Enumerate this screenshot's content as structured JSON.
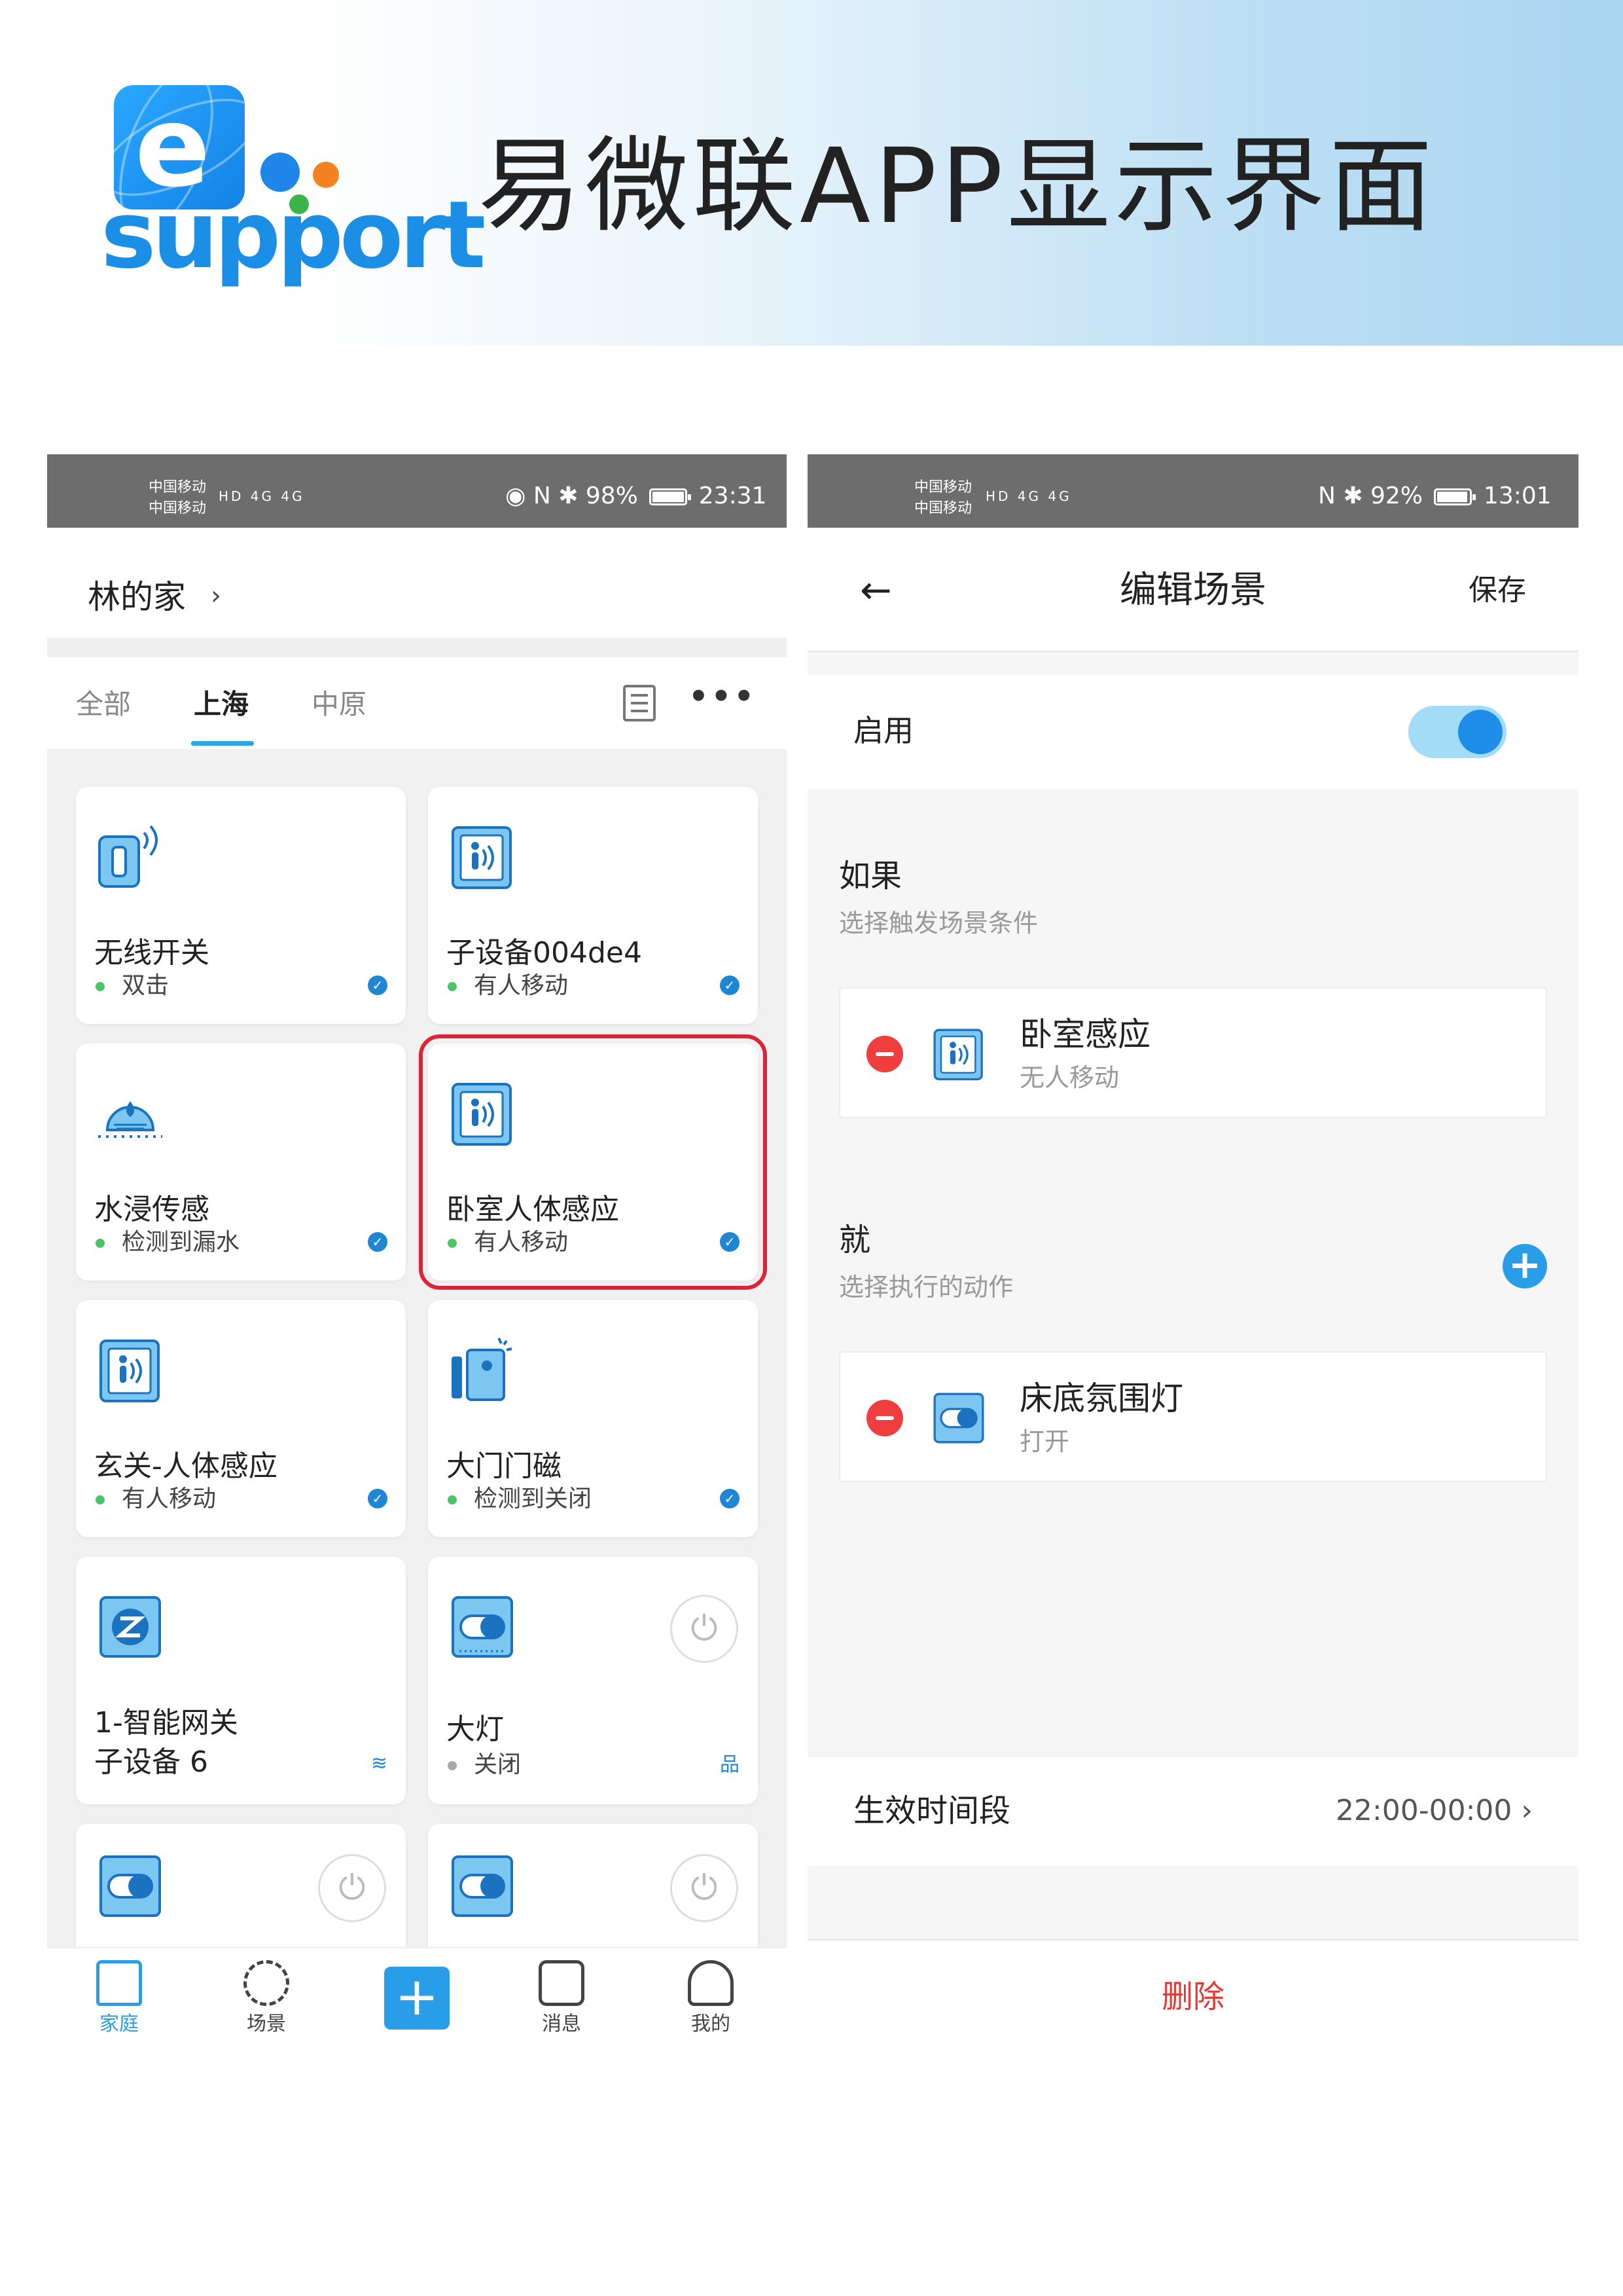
{
  "banner": {
    "logo_text": "support",
    "logo_letter": "e",
    "title": "易微联APP显示界面"
  },
  "left_phone": {
    "status": {
      "carrier1": "中国移动",
      "carrier2": "中国移动",
      "left_icons": "HD 4G 4G",
      "right_icons": "◉ N ✱",
      "battery": "98%",
      "time": "23:31"
    },
    "home_title": "林的家",
    "home_chevron": "›",
    "tabs": [
      {
        "label": "全部"
      },
      {
        "label": "上海"
      },
      {
        "label": "中原"
      }
    ],
    "more": "•••",
    "devices": [
      {
        "name": "无线开关",
        "state": "双击",
        "icon": "wireless-switch-icon"
      },
      {
        "name": "子设备004de4",
        "state": "有人移动",
        "icon": "motion-sensor-icon"
      },
      {
        "name": "水浸传感",
        "state": "检测到漏水",
        "icon": "water-leak-icon"
      },
      {
        "name": "卧室人体感应",
        "state": "有人移动",
        "icon": "motion-sensor-icon"
      },
      {
        "name": "玄关-人体感应",
        "state": "有人移动",
        "icon": "motion-sensor-icon"
      },
      {
        "name": "大门门磁",
        "state": "检测到关闭",
        "icon": "door-sensor-icon"
      },
      {
        "name": "1-智能网关",
        "state": "子设备 6",
        "icon": "zigbee-gateway-icon"
      },
      {
        "name": "大灯",
        "state": "关闭",
        "icon": "switch-icon"
      }
    ],
    "badge_glyph": "✓",
    "wifi_glyph": "≋",
    "network_glyph": "品",
    "power_glyph": "⏻",
    "nav": [
      {
        "label": "家庭"
      },
      {
        "label": "场景"
      },
      {
        "label": "消息"
      },
      {
        "label": "我的"
      }
    ],
    "add": "+"
  },
  "right_phone": {
    "status": {
      "carrier1": "中国移动",
      "carrier2": "中国移动",
      "left_icons": "HD 4G 4G",
      "right_icons": "N ✱",
      "battery": "92%",
      "time": "13:01"
    },
    "back": "←",
    "title": "编辑场景",
    "save": "保存",
    "enable_label": "启用",
    "if_title": "如果",
    "if_sub": "选择触发场景条件",
    "condition": {
      "name": "卧室感应",
      "sub": "无人移动"
    },
    "then_title": "就",
    "then_sub": "选择执行的动作",
    "action": {
      "name": "床底氛围灯",
      "sub": "打开"
    },
    "plus": "+",
    "time_label": "生效时间段",
    "time_value": "22:00-00:00 ›",
    "delete": "删除"
  },
  "colors": {
    "accent": "#2a9de8",
    "highlight": "#e02236",
    "delete": "#e53935",
    "status_green": "#4cc46a"
  }
}
